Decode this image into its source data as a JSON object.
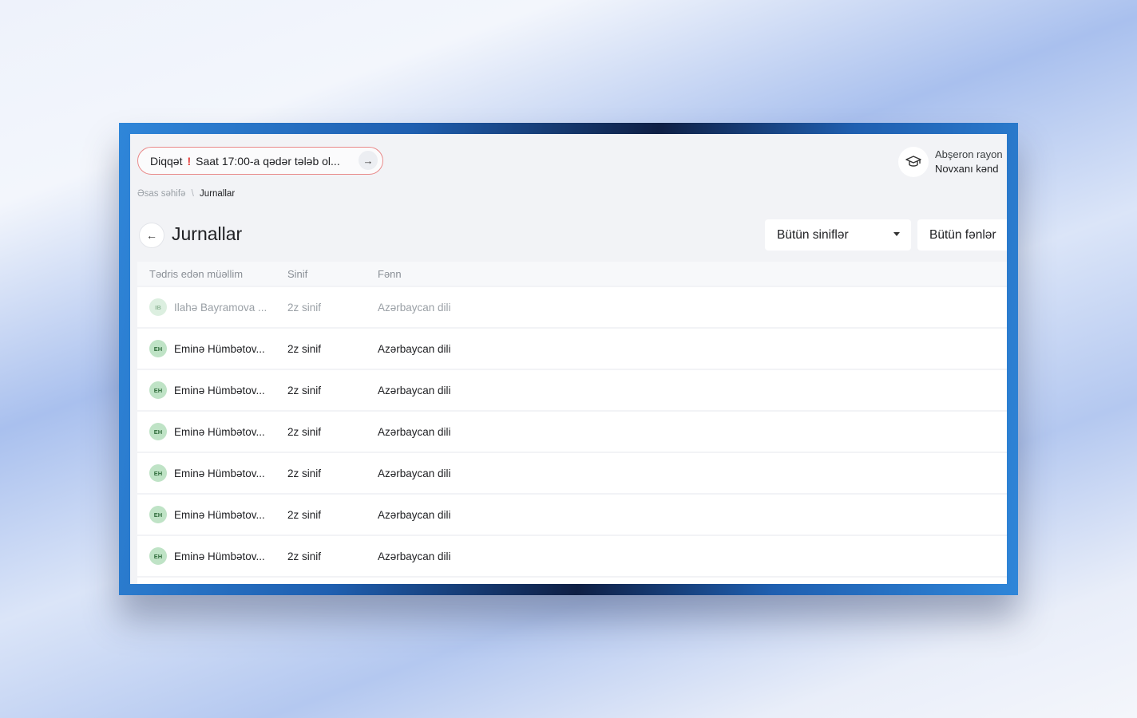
{
  "alert": {
    "prefix": "Diqqət",
    "mark": "!",
    "message": "Saat 17:00-a qədər tələb ol...",
    "arrow_icon": "arrow-right-icon"
  },
  "school": {
    "icon": "graduation-cap-icon",
    "line1": "Abşeron rayon",
    "line2": "Novxanı kənd"
  },
  "breadcrumb": {
    "home": "Əsas səhifə",
    "separator": "\\",
    "current": "Jurnallar"
  },
  "page": {
    "title": "Jurnallar",
    "back_icon": "arrow-left-icon"
  },
  "filters": {
    "classes": "Bütün siniflər",
    "subjects": "Bütün fənlər"
  },
  "table": {
    "headers": [
      "Tədris edən müəllim",
      "Sinif",
      "Fənn"
    ],
    "rows": [
      {
        "initials": "IB",
        "teacher": "Ilahə Bayramova ...",
        "class": "2z sinif",
        "subject": "Azərbaycan dili"
      },
      {
        "initials": "EH",
        "teacher": "Eminə Hümbətov...",
        "class": "2z sinif",
        "subject": "Azərbaycan dili"
      },
      {
        "initials": "EH",
        "teacher": "Eminə Hümbətov...",
        "class": "2z sinif",
        "subject": "Azərbaycan dili"
      },
      {
        "initials": "EH",
        "teacher": "Eminə Hümbətov...",
        "class": "2z sinif",
        "subject": "Azərbaycan dili"
      },
      {
        "initials": "EH",
        "teacher": "Eminə Hümbətov...",
        "class": "2z sinif",
        "subject": "Azərbaycan dili"
      },
      {
        "initials": "EH",
        "teacher": "Eminə Hümbətov...",
        "class": "2z sinif",
        "subject": "Azərbaycan dili"
      },
      {
        "initials": "EH",
        "teacher": "Eminə Hümbətov...",
        "class": "2z sinif",
        "subject": "Azərbaycan dili"
      }
    ]
  },
  "colors": {
    "alert_border": "#e98a8a",
    "alert_mark": "#e53935",
    "avatar_bg": "#bfe3c6",
    "frame_accent": "#2f86d9"
  }
}
